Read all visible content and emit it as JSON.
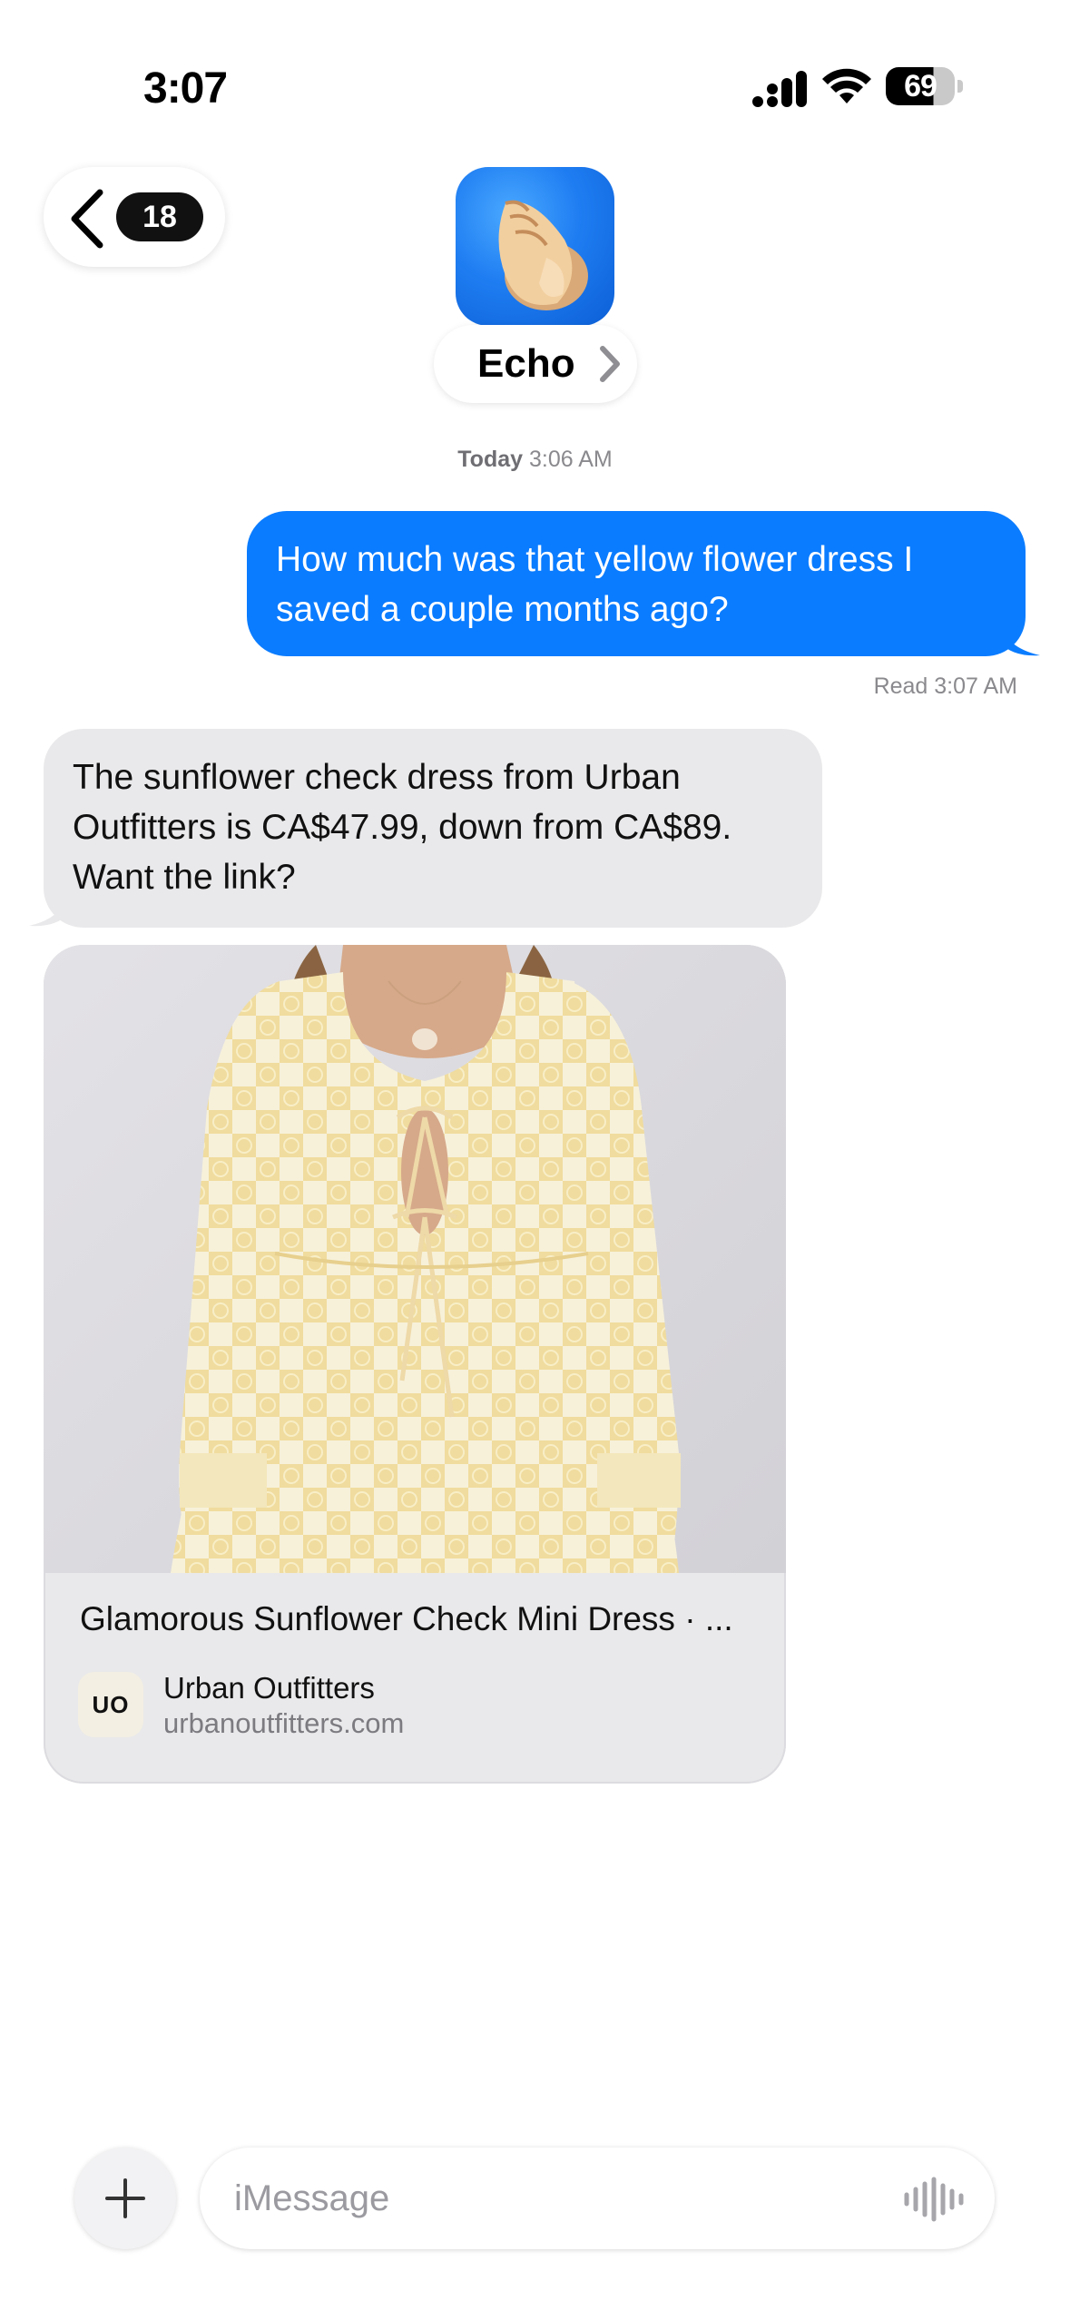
{
  "status_bar": {
    "time": "3:07",
    "battery": "69",
    "battery_level": 0.69
  },
  "header": {
    "back_badge": "18",
    "contact_name": "Echo"
  },
  "conversation": {
    "timestamp_day": "Today",
    "timestamp_time": "3:06 AM",
    "outgoing_message": "How much was that yellow flower dress I saved a couple months ago?",
    "read_receipt": "Read 3:07 AM",
    "incoming_message": "The sunflower check dress from Urban Outfitters is CA$47.99, down from CA$89. Want the link?"
  },
  "link_preview": {
    "title": "Glamorous Sunflower Check Mini Dress · ...",
    "logo_text": "UO",
    "site_name": "Urban Outfitters",
    "domain": "urbanoutfitters.com"
  },
  "input_bar": {
    "placeholder": "iMessage"
  },
  "colors": {
    "outgoing_bubble": "#0a7cff",
    "incoming_bubble": "#e9e9eb",
    "avatar_blue": "#1f7df2"
  },
  "icons": {
    "signal": "cellular-signal-icon",
    "wifi": "wifi-icon",
    "back": "chevron-left-icon",
    "contact_chevron": "chevron-right-icon",
    "avatar": "conch-shell-icon",
    "add": "plus-icon",
    "voice": "waveform-icon"
  }
}
